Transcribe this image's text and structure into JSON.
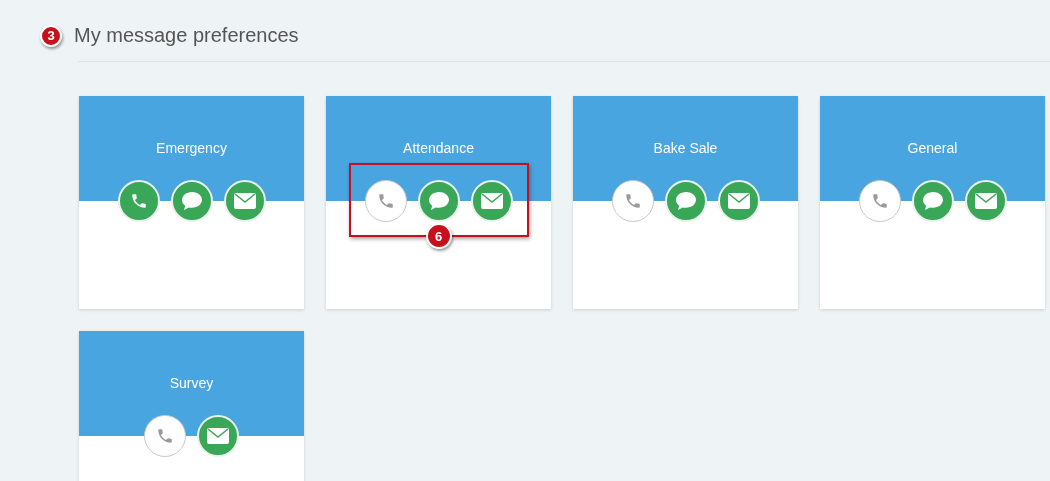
{
  "section": {
    "callout": "3",
    "title": "My message preferences"
  },
  "cards": [
    {
      "title": "Emergency",
      "channels": [
        {
          "kind": "phone",
          "on": true
        },
        {
          "kind": "sms",
          "on": true
        },
        {
          "kind": "email",
          "on": true
        }
      ]
    },
    {
      "title": "Attendance",
      "callout": "6",
      "channels": [
        {
          "kind": "phone",
          "on": false
        },
        {
          "kind": "sms",
          "on": true
        },
        {
          "kind": "email",
          "on": true
        }
      ]
    },
    {
      "title": "Bake Sale",
      "channels": [
        {
          "kind": "phone",
          "on": false
        },
        {
          "kind": "sms",
          "on": true
        },
        {
          "kind": "email",
          "on": true
        }
      ]
    },
    {
      "title": "General",
      "channels": [
        {
          "kind": "phone",
          "on": false
        },
        {
          "kind": "sms",
          "on": true
        },
        {
          "kind": "email",
          "on": true
        }
      ]
    },
    {
      "title": "Survey",
      "channels": [
        {
          "kind": "phone",
          "on": false
        },
        {
          "kind": "email",
          "on": true
        }
      ]
    }
  ]
}
